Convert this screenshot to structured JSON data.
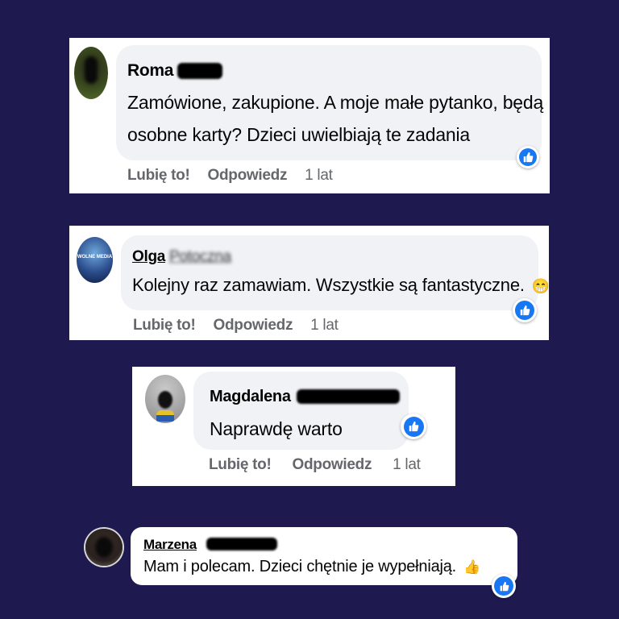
{
  "comments": [
    {
      "name": "Roma",
      "text_line1": "Zamówione, zakupione. A moje małe pytanko, będą",
      "text_line2": "osobne karty? Dzieci uwielbiają te zadania",
      "like": "Lubię to!",
      "reply": "Odpowiedz",
      "time": "1 lat"
    },
    {
      "name": "Olga",
      "name_partial": "Potoczna",
      "text": "Kolejny raz zamawiam. Wszystkie są fantastyczne.",
      "emoji": "😁",
      "avatar_text": "WOLNE MEDIA",
      "like": "Lubię to!",
      "reply": "Odpowiedz",
      "time": "1 lat"
    },
    {
      "name": "Magdalena",
      "text": "Naprawdę warto",
      "like": "Lubię to!",
      "reply": "Odpowiedz",
      "time": "1 lat"
    },
    {
      "name": "Marzena",
      "text": "Mam i polecam. Dzieci chętnie je wypełniają.",
      "emoji": "👍"
    }
  ],
  "colors": {
    "background": "#1e1a4f",
    "bubble": "#f0f2f5",
    "like_blue": "#1877f2",
    "meta_gray": "#65676b"
  },
  "icons": [
    "like-reaction-icon",
    "thumbs-up-icon",
    "grinning-emoji-icon",
    "thumbs-up-emoji-icon"
  ]
}
